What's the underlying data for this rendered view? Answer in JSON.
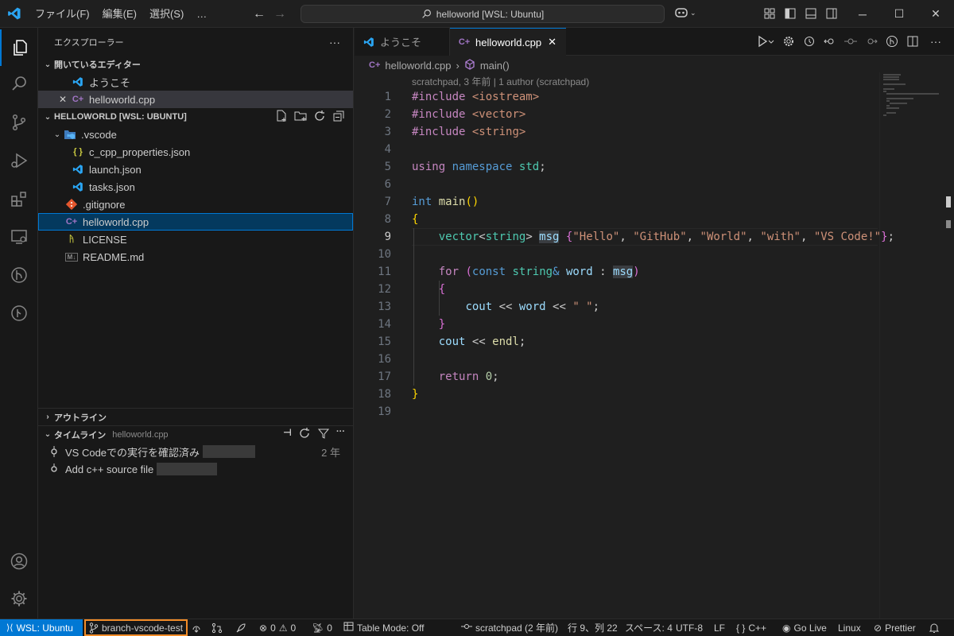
{
  "titlebar": {
    "menu": [
      "ファイル(F)",
      "編集(E)",
      "選択(S)",
      "…"
    ],
    "search": "helloworld [WSL: Ubuntu]"
  },
  "explorer": {
    "title": "エクスプローラー",
    "open_editors_label": "開いているエディター",
    "open_editors": [
      "ようこそ",
      "helloworld.cpp"
    ],
    "workspace_label": "HELLOWORLD [WSL: UBUNTU]",
    "vscode_folder": ".vscode",
    "vscode_files": [
      "c_cpp_properties.json",
      "launch.json",
      "tasks.json"
    ],
    "root_files": [
      ".gitignore",
      "helloworld.cpp",
      "LICENSE",
      "README.md"
    ],
    "outline_label": "アウトライン",
    "timeline_label": "タイムライン",
    "timeline_file": "helloworld.cpp",
    "timeline_items": [
      {
        "message": "VS Codeでの実行を確認済み",
        "age": "2 年"
      },
      {
        "message": "Add c++ source file",
        "age": ""
      }
    ]
  },
  "editor": {
    "tabs": [
      "ようこそ",
      "helloworld.cpp"
    ],
    "breadcrumb": [
      "helloworld.cpp",
      "main()"
    ],
    "blame": "scratchpad, 3 年前 | 1 author (scratchpad)",
    "line_numbers": [
      "1",
      "2",
      "3",
      "4",
      "5",
      "6",
      "7",
      "8",
      "9",
      "10",
      "11",
      "12",
      "13",
      "14",
      "15",
      "16",
      "17",
      "18",
      "19"
    ],
    "current_line": "9"
  },
  "statusbar": {
    "remote": "WSL: Ubuntu",
    "branch": "branch-vscode-test",
    "problems": "0",
    "warnings": "0",
    "ports": "0",
    "table_mode": "Table Mode: Off",
    "blame": "scratchpad (2 年前)",
    "position": "行 9、列 22",
    "spaces": "スペース: 4",
    "encoding": "UTF-8",
    "eol": "LF",
    "language": "C++",
    "golive": "Go Live",
    "os": "Linux",
    "prettier": "Prettier"
  },
  "colors": {
    "accent": "#0078d4",
    "branch_highlight": "#f28c28"
  }
}
